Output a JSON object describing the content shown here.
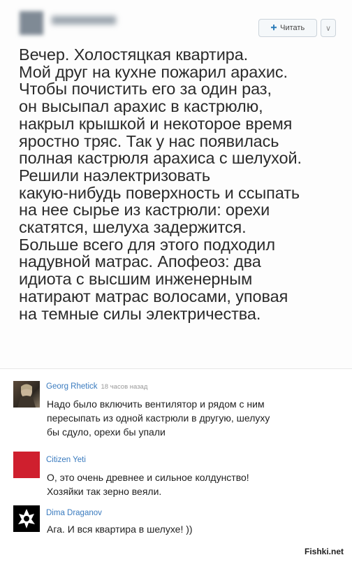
{
  "tweet": {
    "follow_label": "Читать",
    "follow_icon": "add-user-icon",
    "lines": [
      "Вечер. Холостяцкая квартира.",
      "Мой друг на кухне пожарил арахис.",
      "Чтобы почистить его за один раз,",
      "он высыпал арахис в кастрюлю,",
      "накрыл крышкой и некоторое время",
      "яростно тряс. Так у нас появилась",
      "полная кастрюля арахиса с шелухой.",
      "Решили наэлектризовать",
      "какую-нибудь поверхность и ссыпать",
      "на нее сырье из кастрюли: орехи",
      "скатятся, шелуха задержится.",
      "Больше всего для этого подходил",
      "надувной матрас. Апофеоз: два",
      "идиота с высшим инженерным",
      "натирают матрас волосами, уповая",
      "на темные силы электричества."
    ]
  },
  "comments": [
    {
      "author": "Georg Rhetick",
      "time": "18 часов назад",
      "lines": [
        "Надо было включить вентилятор и рядом с ним",
        "пересыпать из одной кастрюли в другую, шелуху",
        "бы сдуло, орехи бы упали"
      ]
    },
    {
      "author": "Citizen Yeti",
      "lines": [
        "О, это очень древнее и сильное колдунство!",
        "Хозяйки так зерно веяли."
      ]
    },
    {
      "author": "Dima Draganov",
      "lines": [
        "Ага. И вся квартира в шелухе! ))"
      ]
    }
  ],
  "watermark": "Fishki.net"
}
